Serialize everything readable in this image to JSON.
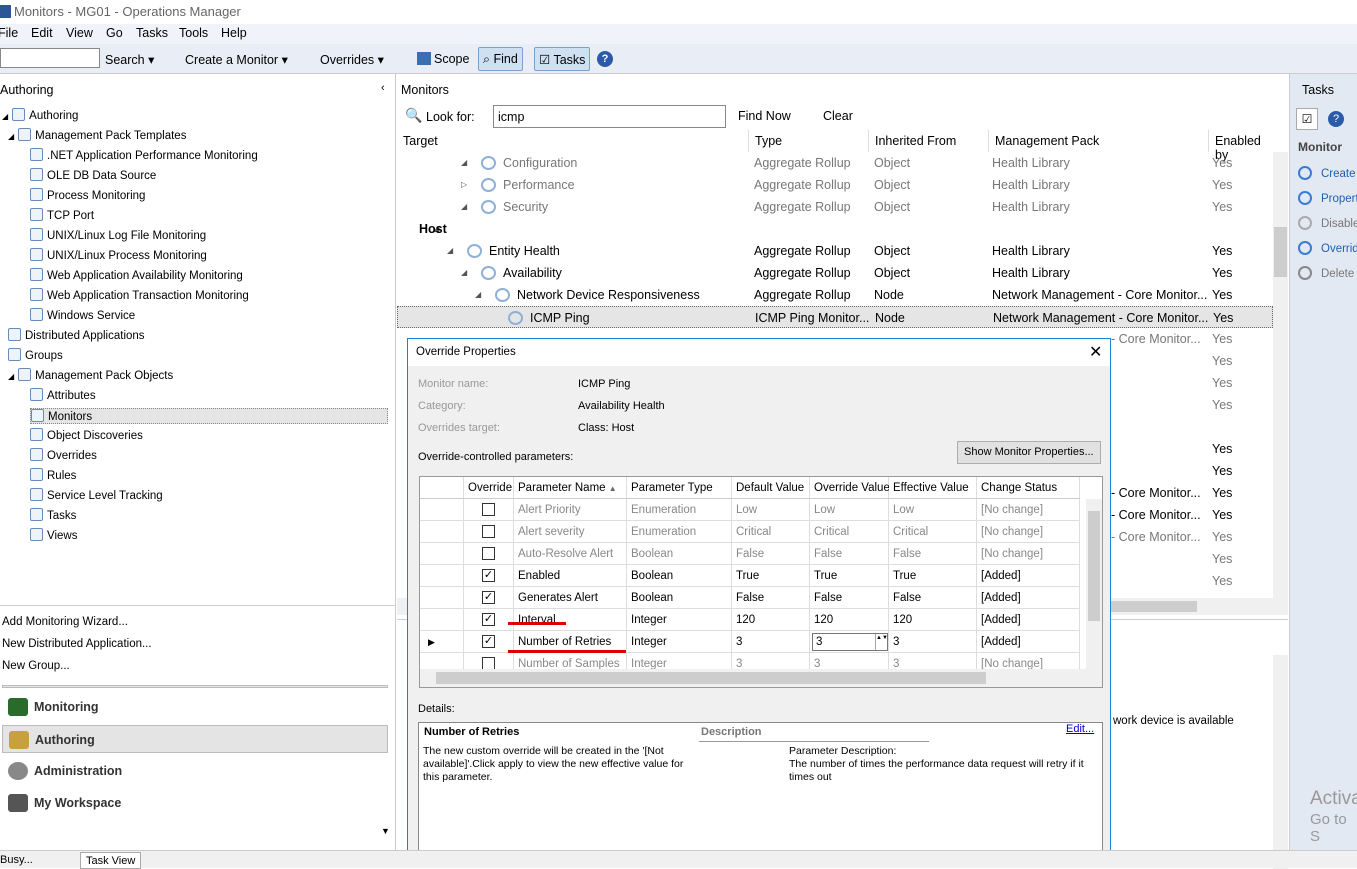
{
  "window": {
    "title": "Monitors - MG01 - Operations Manager"
  },
  "menu": [
    "File",
    "Edit",
    "View",
    "Go",
    "Tasks",
    "Tools",
    "Help"
  ],
  "toolbar": {
    "search_value": "",
    "search": "Search",
    "create_monitor": "Create a Monitor",
    "overrides": "Overrides",
    "scope": "Scope",
    "find": "Find",
    "tasks": "Tasks"
  },
  "left": {
    "title": "Authoring",
    "tree": [
      {
        "label": "Authoring",
        "level": 0,
        "exp": "◢"
      },
      {
        "label": "Management Pack Templates",
        "level": 1,
        "exp": "◢"
      },
      {
        "label": ".NET Application Performance Monitoring",
        "level": 2
      },
      {
        "label": "OLE DB Data Source",
        "level": 2
      },
      {
        "label": "Process Monitoring",
        "level": 2
      },
      {
        "label": "TCP Port",
        "level": 2
      },
      {
        "label": "UNIX/Linux Log File Monitoring",
        "level": 2
      },
      {
        "label": "UNIX/Linux Process Monitoring",
        "level": 2
      },
      {
        "label": "Web Application Availability Monitoring",
        "level": 2
      },
      {
        "label": "Web Application Transaction Monitoring",
        "level": 2
      },
      {
        "label": "Windows Service",
        "level": 2
      },
      {
        "label": "Distributed Applications",
        "level": 1
      },
      {
        "label": "Groups",
        "level": 1
      },
      {
        "label": "Management Pack Objects",
        "level": 1,
        "exp": "◢"
      },
      {
        "label": "Attributes",
        "level": 2
      },
      {
        "label": "Monitors",
        "level": 2,
        "selected": true
      },
      {
        "label": "Object Discoveries",
        "level": 2
      },
      {
        "label": "Overrides",
        "level": 2
      },
      {
        "label": "Rules",
        "level": 2
      },
      {
        "label": "Service Level Tracking",
        "level": 2
      },
      {
        "label": "Tasks",
        "level": 2
      },
      {
        "label": "Views",
        "level": 2
      }
    ],
    "links": [
      "Add Monitoring Wizard...",
      "New Distributed Application...",
      "New Group..."
    ],
    "workspaces": [
      {
        "label": "Monitoring",
        "color": "#2a6a2a"
      },
      {
        "label": "Authoring",
        "color": "#c8a040",
        "active": true
      },
      {
        "label": "Administration",
        "color": "#777"
      },
      {
        "label": "My Workspace",
        "color": "#555"
      }
    ]
  },
  "main": {
    "title": "Monitors",
    "look_for_label": "Look for:",
    "look_for_value": "icmp",
    "find_now": "Find Now",
    "clear": "Clear",
    "columns": [
      "Target",
      "Type",
      "Inherited From",
      "Management Pack",
      "Enabled by"
    ],
    "rows": [
      {
        "indent": 36,
        "exp": "◢",
        "name": "Configuration",
        "type": "Aggregate Rollup",
        "inh": "Object",
        "mp": "Health Library",
        "en": "Yes",
        "grey": true
      },
      {
        "indent": 36,
        "exp": "▷",
        "name": "Performance",
        "type": "Aggregate Rollup",
        "inh": "Object",
        "mp": "Health Library",
        "en": "Yes",
        "grey": true
      },
      {
        "indent": 36,
        "exp": "◢",
        "name": "Security",
        "type": "Aggregate Rollup",
        "inh": "Object",
        "mp": "Health Library",
        "en": "Yes",
        "grey": true
      },
      {
        "indent": 8,
        "exp": "◢",
        "name": "Host",
        "group": true
      },
      {
        "indent": 22,
        "exp": "◢",
        "name": "Entity Health",
        "type": "Aggregate Rollup",
        "inh": "Object",
        "mp": "Health Library",
        "en": "Yes"
      },
      {
        "indent": 36,
        "exp": "◢",
        "name": "Availability",
        "type": "Aggregate Rollup",
        "inh": "Object",
        "mp": "Health Library",
        "en": "Yes"
      },
      {
        "indent": 50,
        "exp": "◢",
        "name": "Network Device Responsiveness",
        "type": "Aggregate Rollup",
        "inh": "Node",
        "mp": "Network Management - Core Monitor...",
        "en": "Yes"
      },
      {
        "indent": 62,
        "name": "ICMP Ping",
        "type": "ICMP Ping Monitor...",
        "inh": "Node",
        "mp": "Network Management - Core Monitor...",
        "en": "Yes",
        "selected": true
      },
      {
        "mp": "- Core Monitor...",
        "en": "Yes",
        "grey": true,
        "hidden": true
      },
      {
        "en": "Yes",
        "grey": true,
        "hidden": true
      },
      {
        "en": "Yes",
        "grey": true,
        "hidden": true
      },
      {
        "en": "Yes",
        "grey": true,
        "hidden": true
      },
      {
        "hidden": true
      },
      {
        "en": "Yes",
        "hidden": true
      },
      {
        "en": "Yes",
        "hidden": true
      },
      {
        "mp": "- Core Monitor...",
        "en": "Yes",
        "hidden": true
      },
      {
        "mp": "- Core Monitor...",
        "en": "Yes",
        "hidden": true
      },
      {
        "mp": "- Core Monitor...",
        "en": "Yes",
        "grey": true,
        "hidden": true
      },
      {
        "en": "Yes",
        "grey": true,
        "hidden": true
      },
      {
        "en": "Yes",
        "grey": true,
        "hidden": true
      }
    ],
    "detail_fragment": "work device is available"
  },
  "tasks": {
    "title": "Tasks",
    "section": "Monitor",
    "items": [
      "Create a",
      "Propert",
      "Disable",
      "Overrid",
      "Delete"
    ]
  },
  "dialog": {
    "title": "Override Properties",
    "monitor_name_label": "Monitor name:",
    "monitor_name": "ICMP Ping",
    "category_label": "Category:",
    "category": "Availability Health",
    "target_label": "Overrides target:",
    "target": "Class: Host",
    "show_props": "Show Monitor Properties...",
    "params_label": "Override-controlled parameters:",
    "columns": [
      "Override",
      "Parameter Name",
      "Parameter Type",
      "Default Value",
      "Override Value",
      "Effective Value",
      "Change Status"
    ],
    "rows": [
      {
        "checked": false,
        "name": "Alert Priority",
        "type": "Enumeration",
        "def": "Low",
        "ov": "Low",
        "eff": "Low",
        "status": "[No change]",
        "grey": true
      },
      {
        "checked": false,
        "name": "Alert severity",
        "type": "Enumeration",
        "def": "Critical",
        "ov": "Critical",
        "eff": "Critical",
        "status": "[No change]",
        "grey": true
      },
      {
        "checked": false,
        "name": "Auto-Resolve Alert",
        "type": "Boolean",
        "def": "False",
        "ov": "False",
        "eff": "False",
        "status": "[No change]",
        "grey": true
      },
      {
        "checked": true,
        "name": "Enabled",
        "type": "Boolean",
        "def": "True",
        "ov": "True",
        "eff": "True",
        "status": "[Added]"
      },
      {
        "checked": true,
        "name": "Generates Alert",
        "type": "Boolean",
        "def": "False",
        "ov": "False",
        "eff": "False",
        "status": "[Added]"
      },
      {
        "checked": true,
        "name": "Interval",
        "type": "Integer",
        "def": "120",
        "ov": "120",
        "eff": "120",
        "status": "[Added]"
      },
      {
        "checked": true,
        "name": "Number of Retries",
        "type": "Integer",
        "def": "3",
        "ov": "3",
        "eff": "3",
        "status": "[Added]",
        "current": true
      },
      {
        "checked": false,
        "name": "Number of Samples",
        "type": "Integer",
        "def": "3",
        "ov": "3",
        "eff": "3",
        "status": "[No change]",
        "grey": true
      }
    ],
    "details_label": "Details:",
    "details_title": "Number of Retries",
    "description_header": "Description",
    "edit": "Edit...",
    "details_text": "The new custom override will be created in the '[Not available]'.Click apply to view  the new effective value for this parameter.",
    "param_desc_label": "Parameter Description:",
    "param_desc": "The number of times the performance data request will retry if it times out"
  },
  "status": {
    "left": "Busy...",
    "tab": "Task View"
  },
  "watermark": {
    "line1": "Activa",
    "line2": "Go to S"
  }
}
